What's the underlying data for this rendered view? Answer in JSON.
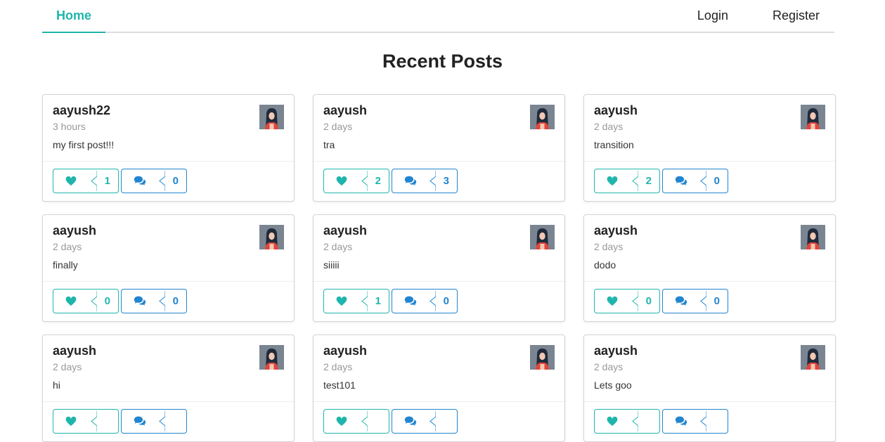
{
  "nav": {
    "home": "Home",
    "login": "Login",
    "register": "Register"
  },
  "page_title": "Recent Posts",
  "colors": {
    "accent": "#1fb5ac",
    "comment_blue": "#2185d0"
  },
  "posts": [
    {
      "author": "aayush22",
      "time": "3 hours",
      "text": "my first post!!!",
      "likes": "1",
      "comments": "0"
    },
    {
      "author": "aayush",
      "time": "2 days",
      "text": "tra",
      "likes": "2",
      "comments": "3"
    },
    {
      "author": "aayush",
      "time": "2 days",
      "text": "transition",
      "likes": "2",
      "comments": "0"
    },
    {
      "author": "aayush",
      "time": "2 days",
      "text": "finally",
      "likes": "0",
      "comments": "0"
    },
    {
      "author": "aayush",
      "time": "2 days",
      "text": "siiiii",
      "likes": "1",
      "comments": "0"
    },
    {
      "author": "aayush",
      "time": "2 days",
      "text": "dodo",
      "likes": "0",
      "comments": "0"
    },
    {
      "author": "aayush",
      "time": "2 days",
      "text": "hi",
      "likes": "",
      "comments": ""
    },
    {
      "author": "aayush",
      "time": "2 days",
      "text": "test101",
      "likes": "",
      "comments": ""
    },
    {
      "author": "aayush",
      "time": "2 days",
      "text": "Lets goo",
      "likes": "",
      "comments": ""
    }
  ]
}
